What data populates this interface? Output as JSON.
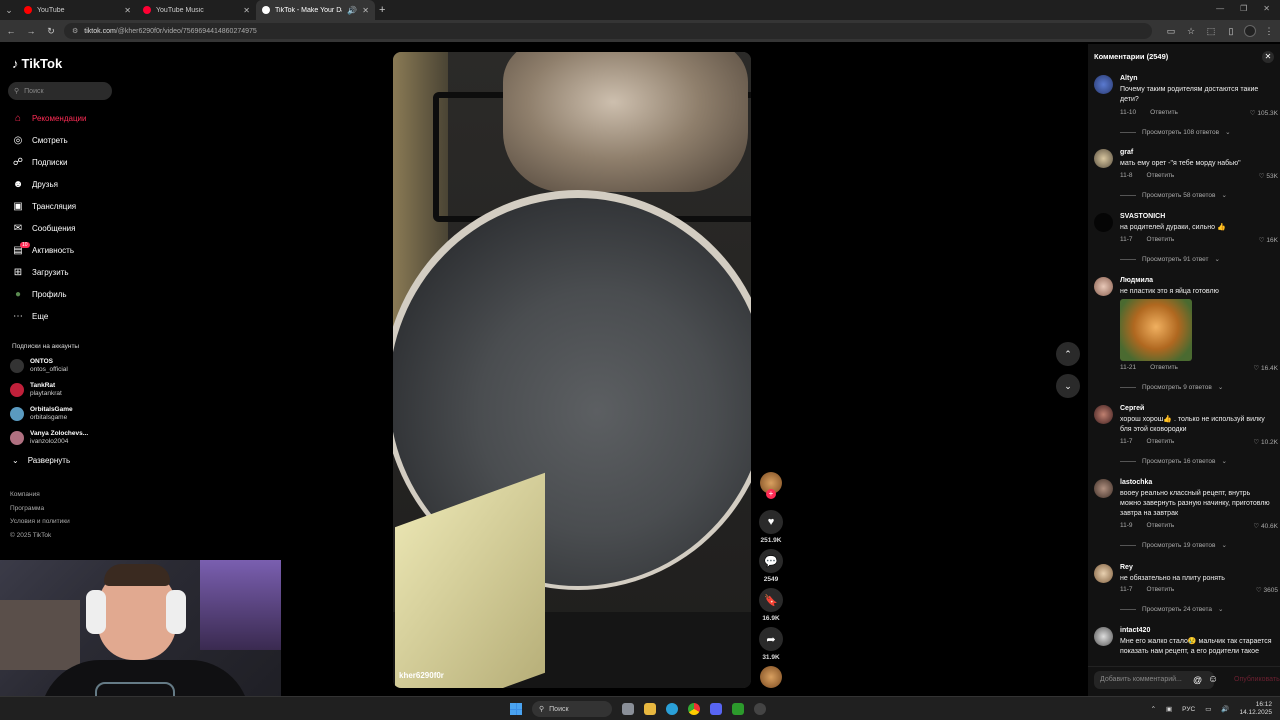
{
  "browser": {
    "tabs": [
      {
        "title": "YouTube",
        "color": "#ff0000"
      },
      {
        "title": "YouTube Music",
        "color": "#ff0033"
      },
      {
        "title": "TikTok - Make Your Day",
        "color": "#ffffff",
        "active": true
      }
    ],
    "url_host": "tiktok.com",
    "url_path": "/@kher6290f0r/video/7569694414860274975"
  },
  "nav": {
    "logo": "TikTok",
    "search_placeholder": "Поиск",
    "items": [
      {
        "label": "Рекомендации",
        "icon": "home-icon",
        "active": true
      },
      {
        "label": "Смотреть",
        "icon": "compass-icon"
      },
      {
        "label": "Подписки",
        "icon": "following-icon"
      },
      {
        "label": "Друзья",
        "icon": "friends-icon"
      },
      {
        "label": "Трансляция",
        "icon": "live-icon"
      },
      {
        "label": "Сообщения",
        "icon": "messages-icon"
      },
      {
        "label": "Активность",
        "icon": "activity-icon",
        "badge": "10"
      },
      {
        "label": "Загрузить",
        "icon": "upload-icon"
      },
      {
        "label": "Профиль",
        "icon": "profile-icon"
      },
      {
        "label": "Еще",
        "icon": "more-icon"
      }
    ],
    "subs_title": "Подписки на аккаунты",
    "accounts": [
      {
        "name": "ONTOS",
        "handle": "ontos_official"
      },
      {
        "name": "TankRat",
        "handle": "playtankrat"
      },
      {
        "name": "OrbitalsGame",
        "handle": "orbitalsgame"
      },
      {
        "name": "Vanya Zolochevs...",
        "handle": "ivanzolo2004"
      }
    ],
    "expand_label": "Развернуть",
    "footer": [
      "Компания",
      "Программа",
      "Условия и политики",
      "© 2025 TikTok"
    ]
  },
  "video": {
    "author": "kher6290f0r",
    "likes": "251.9K",
    "comments": "2549",
    "saves": "16.9K",
    "shares": "31.9K"
  },
  "comments_panel": {
    "title": "Комментарии (2549)",
    "reply_label": "Ответить",
    "items": [
      {
        "user": "Altyn",
        "text": "Почему таким родителям достаются такие дети?",
        "date": "11-10",
        "likes": "105.3K",
        "more": "Просмотреть 108 ответов"
      },
      {
        "user": "graf",
        "text": "мать ему орет -\"я тебе морду набью\"",
        "date": "11-8",
        "likes": "53K",
        "more": "Просмотреть 58 ответов"
      },
      {
        "user": "SVASTONICH",
        "text": "на родителей дураки, сильно 👍",
        "date": "11-7",
        "likes": "16K",
        "more": "Просмотреть 91 ответ"
      },
      {
        "user": "Людмила",
        "text": "не пластик это я яйца готовлю",
        "date": "11-21",
        "likes": "16.4K",
        "more": "Просмотреть 9 ответов"
      },
      {
        "user": "Сергей",
        "text": "хорош хорош👍 . только не используй вилку бля этой сковородки",
        "date": "11-7",
        "likes": "10.2K",
        "more": "Просмотреть 16 ответов"
      },
      {
        "user": "lastochka",
        "text": "вооеу реально классный рецепт, внутрь можно завернуть разную начинку, приготовлю завтра на завтрак",
        "date": "11-9",
        "likes": "40.6K",
        "more": "Просмотреть 19 ответов"
      },
      {
        "user": "Rey",
        "text": "не обязательно на плиту ронять",
        "date": "11-7",
        "likes": "3605",
        "more": "Просмотреть 24 ответа"
      },
      {
        "user": "intact420",
        "text": "Мне его жалко стало😢 мальчик так старается показать нам рецепт, а его родители такое"
      }
    ],
    "add_placeholder": "Добавить комментарий...",
    "send_label": "Опубликовать"
  },
  "taskbar": {
    "search": "Поиск",
    "lang": "РУС",
    "time": "16:12",
    "date": "14.12.2025"
  }
}
